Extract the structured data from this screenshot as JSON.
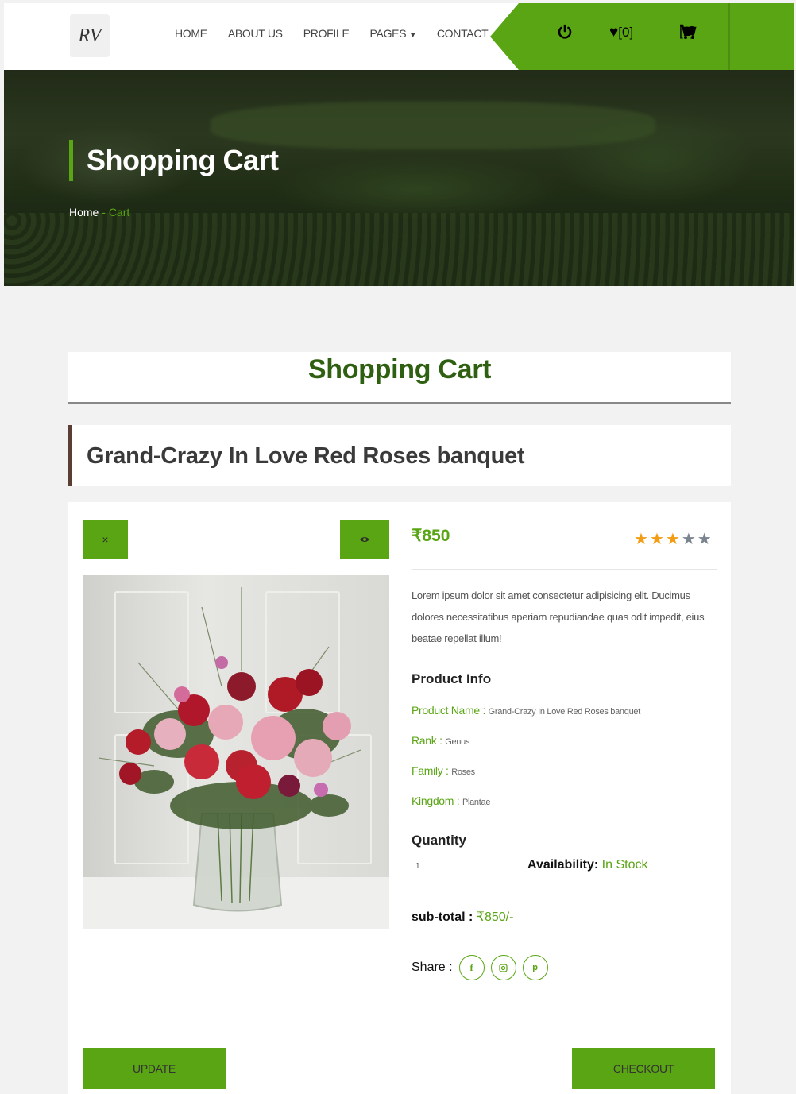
{
  "header": {
    "logo_text": "RV",
    "nav": [
      {
        "label": "HOME"
      },
      {
        "label": "ABOUT US"
      },
      {
        "label": "PROFILE"
      },
      {
        "label": "PAGES"
      },
      {
        "label": "CONTACT"
      }
    ],
    "wishlist_count": "[0]",
    "cart_count": "[1]",
    "accent": "#5aa514"
  },
  "hero": {
    "title": "Shopping Cart",
    "breadcrumb_home": "Home",
    "breadcrumb_sep": " - ",
    "breadcrumb_current": "Cart"
  },
  "main": {
    "section_title": "Shopping Cart",
    "product_title": "Grand-Crazy In Love Red Roses banquet",
    "price": "₹850",
    "rating": {
      "value": 3,
      "max": 5
    },
    "description": "Lorem ipsum dolor sit amet consectetur adipisicing elit. Ducimus dolores necessitatibus aperiam repudiandae quas odit impedit, eius beatae repellat illum!",
    "info_heading": "Product Info",
    "info": [
      {
        "key": "Product Name",
        "value": "Grand-Crazy In Love Red Roses banquet"
      },
      {
        "key": "Rank",
        "value": "Genus"
      },
      {
        "key": "Family",
        "value": "Roses"
      },
      {
        "key": "Kingdom",
        "value": "Plantae"
      }
    ],
    "quantity_label": "Quantity",
    "quantity_value": "1",
    "availability_label": "Availability:",
    "availability_value": "In Stock",
    "subtotal_label": "sub-total :",
    "subtotal_value": "₹850/-",
    "share_label": "Share :",
    "remove_symbol": "×",
    "update_label": "UPDATE",
    "checkout_label": "CHECKOUT"
  }
}
